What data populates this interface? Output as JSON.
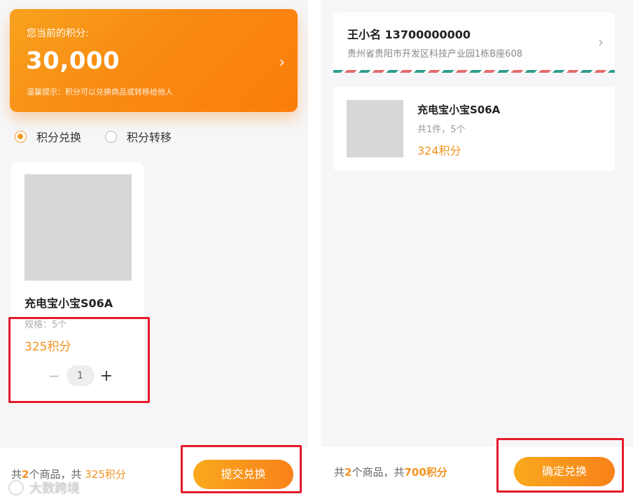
{
  "left": {
    "points_card": {
      "label": "您当前的积分:",
      "value": "30,000",
      "tip": "温馨提示：积分可以兑换商品或转移给他人",
      "chevron": "›"
    },
    "options": {
      "exchange": "积分兑换",
      "transfer": "积分转移"
    },
    "product": {
      "name": "充电宝小宝S06A",
      "spec": "规格：5个",
      "points": "325积分",
      "minus": "−",
      "quantity": "1",
      "plus": "+"
    },
    "footer": {
      "prefix": "共",
      "count": "2",
      "middle": "个商品，共 ",
      "total": "325积分",
      "submit_label": "提交兑换"
    },
    "watermark": "大数跨境"
  },
  "right": {
    "address": {
      "name_phone": "王小名 13700000000",
      "address": "贵州省贵阳市开发区科技产业园1栋B座608",
      "chevron": "›"
    },
    "order": {
      "name": "充电宝小宝S06A",
      "qty_spec": "共1件，5个",
      "points": "324积分"
    },
    "footer": {
      "prefix": "共",
      "count": "2",
      "middle": "个商品，共",
      "total": "700积分",
      "confirm_label": "确定兑换"
    }
  },
  "colors": {
    "accent": "#f29322",
    "highlight_border": "#e51a2a"
  }
}
